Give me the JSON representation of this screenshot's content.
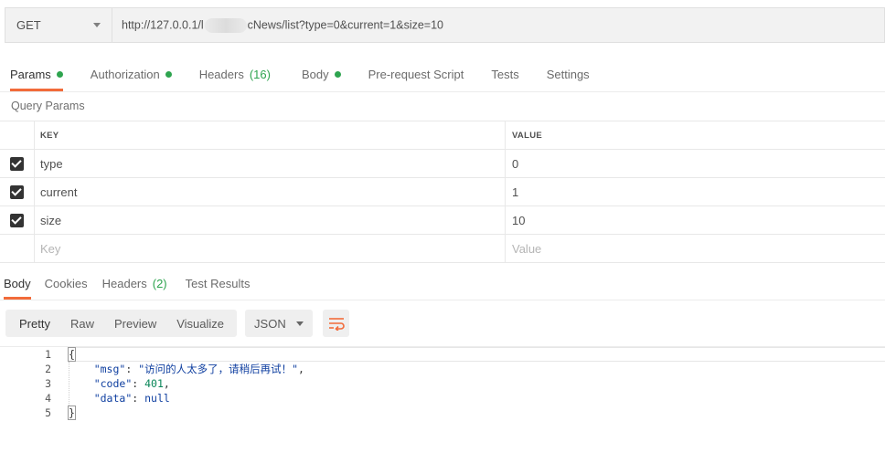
{
  "request": {
    "method": "GET",
    "url_prefix": "http://127.0.0.1/l",
    "url_suffix": "cNews/list?type=0&current=1&size=10"
  },
  "request_tabs": [
    {
      "label": "Params",
      "dot": true
    },
    {
      "label": "Authorization",
      "dot": true
    },
    {
      "label": "Headers",
      "count": "(16)"
    },
    {
      "label": "Body",
      "dot": true
    },
    {
      "label": "Pre-request Script"
    },
    {
      "label": "Tests"
    },
    {
      "label": "Settings"
    }
  ],
  "query_params": {
    "title": "Query Params",
    "col_key": "KEY",
    "col_value": "VALUE",
    "rows": [
      {
        "key": "type",
        "value": "0"
      },
      {
        "key": "current",
        "value": "1"
      },
      {
        "key": "size",
        "value": "10"
      }
    ],
    "placeholder_key": "Key",
    "placeholder_value": "Value"
  },
  "response_tabs": [
    {
      "label": "Body"
    },
    {
      "label": "Cookies"
    },
    {
      "label": "Headers",
      "count": "(2)"
    },
    {
      "label": "Test Results"
    }
  ],
  "toolbar": {
    "formats": [
      "Pretty",
      "Raw",
      "Preview",
      "Visualize"
    ],
    "language": "JSON"
  },
  "response_body": {
    "line_numbers": [
      "1",
      "2",
      "3",
      "4",
      "5"
    ],
    "open_brace": "{",
    "close_brace": "}",
    "msg_key": "\"msg\"",
    "msg_value": "\"访问的人太多了，请稍后再试！\"",
    "code_key": "\"code\"",
    "code_value": "401",
    "data_key": "\"data\"",
    "data_value": "null"
  },
  "colors": {
    "accent": "#f26b3a",
    "status_dot": "#2ea44f"
  }
}
